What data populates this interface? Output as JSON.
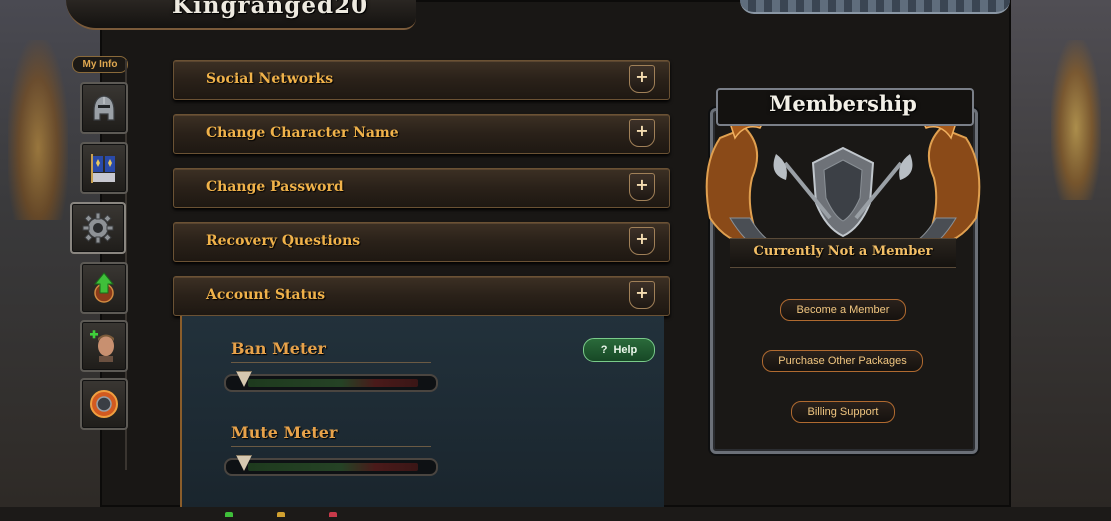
{
  "header": {
    "character_name": "Kingranged20"
  },
  "sidebar": {
    "tab_label": "My Info",
    "items": [
      {
        "name": "helmet-icon"
      },
      {
        "name": "banner-icon"
      },
      {
        "name": "gear-icon"
      },
      {
        "name": "level-up-icon"
      },
      {
        "name": "add-character-icon"
      },
      {
        "name": "shield-ring-icon"
      }
    ]
  },
  "accordion": {
    "expand_symbol": "+",
    "sections": [
      {
        "label": "Social Networks"
      },
      {
        "label": "Change Character Name"
      },
      {
        "label": "Change Password"
      },
      {
        "label": "Recovery Questions"
      },
      {
        "label": "Account Status"
      }
    ]
  },
  "account_status": {
    "help_icon": "?",
    "help_label": "Help",
    "ban_meter": {
      "label": "Ban Meter",
      "level": 0
    },
    "mute_meter": {
      "label": "Mute Meter",
      "level": 0
    }
  },
  "membership": {
    "title": "Membership",
    "status": "Currently Not a Member",
    "buttons": {
      "become": "Become a Member",
      "purchase": "Purchase Other Packages",
      "billing": "Billing Support"
    }
  },
  "colors": {
    "accent_gold": "#f0b24a",
    "help_green": "#2a6a3a",
    "panel_blue": "#22313b"
  }
}
